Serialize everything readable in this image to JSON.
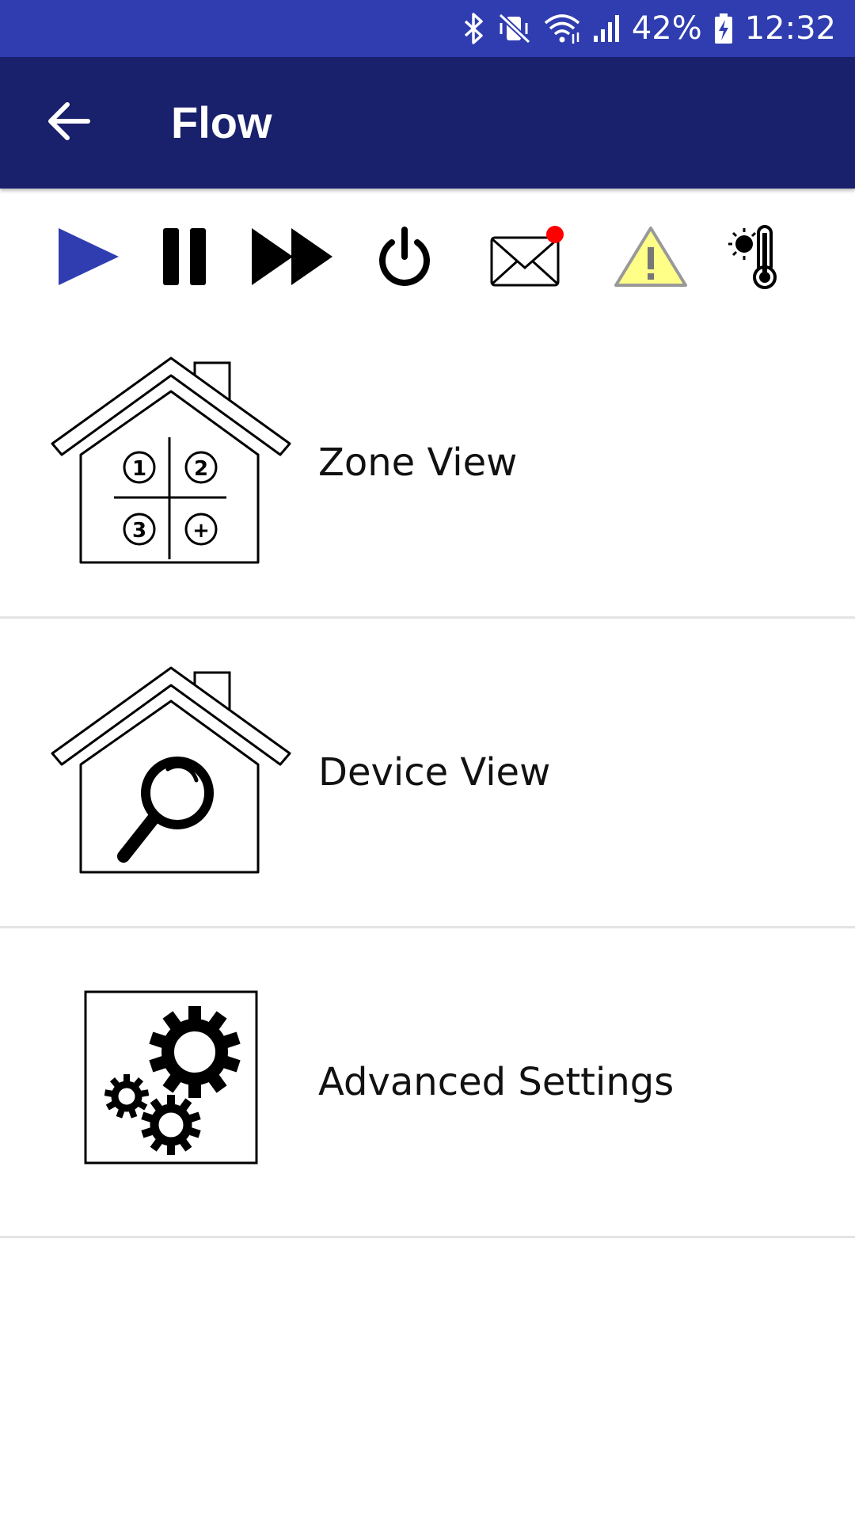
{
  "status_bar": {
    "battery_percent": "42%",
    "time": "12:32",
    "icons": [
      "bluetooth-icon",
      "vibrate-mute-icon",
      "wifi-icon",
      "signal-icon",
      "battery-charging-icon"
    ]
  },
  "app_bar": {
    "title": "Flow",
    "back_icon": "arrow-left-icon"
  },
  "toolbar": {
    "items": [
      {
        "name": "play",
        "icon": "play-icon",
        "color": "#2f3db0"
      },
      {
        "name": "pause",
        "icon": "pause-icon"
      },
      {
        "name": "fast-forward",
        "icon": "fast-forward-icon"
      },
      {
        "name": "power",
        "icon": "power-icon"
      },
      {
        "name": "messages",
        "icon": "envelope-icon",
        "badge_color": "#ff0000"
      },
      {
        "name": "warning",
        "icon": "warning-icon",
        "color": "#ffff88"
      },
      {
        "name": "temperature",
        "icon": "thermometer-sun-icon"
      }
    ]
  },
  "menu": {
    "items": [
      {
        "label": "Zone View",
        "icon": "house-zones-icon",
        "zones": [
          "1",
          "2",
          "3",
          "+"
        ]
      },
      {
        "label": "Device View",
        "icon": "house-magnifier-icon"
      },
      {
        "label": "Advanced Settings",
        "icon": "gears-icon"
      }
    ]
  },
  "colors": {
    "status_bar": "#2f3db0",
    "app_bar": "#19206c",
    "divider": "#e4e4e4"
  }
}
